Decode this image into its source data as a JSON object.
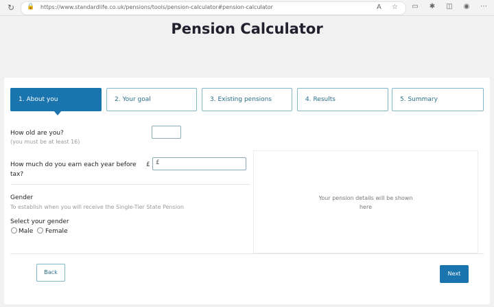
{
  "browser": {
    "url": "https://www.standardlife.co.uk/pensions/tools/pension-calculator#pension-calculator",
    "icons": [
      "reload-icon",
      "lock-icon",
      "read-aloud-icon",
      "favorite-icon",
      "tab-icon",
      "extensions-icon",
      "collections-icon",
      "profile-icon",
      "more-icon"
    ]
  },
  "page": {
    "title": "Pension Calculator"
  },
  "steps": [
    {
      "label": "1. About you",
      "active": true
    },
    {
      "label": "2. Your goal",
      "active": false
    },
    {
      "label": "3. Existing pensions",
      "active": false
    },
    {
      "label": "4. Results",
      "active": false
    },
    {
      "label": "5. Summary",
      "active": false
    }
  ],
  "form": {
    "age": {
      "label": "How old are you?",
      "hint": "(you must be at least 16)",
      "value": ""
    },
    "earnings": {
      "label_line1": "How much do you earn each year before",
      "label_line2": "tax?",
      "currency": "£",
      "value": "£"
    },
    "gender": {
      "title": "Gender",
      "hint": "To establish when you will receive the Single-Tier State Pension",
      "select_label": "Select your gender",
      "options": [
        "Male",
        "Female"
      ]
    }
  },
  "panel": {
    "line1": "Your pension details will be shown",
    "line2": "here"
  },
  "buttons": {
    "back": "Back",
    "next": "Next"
  },
  "colors": {
    "primary": "#1a74ae",
    "border": "#7fb6c8"
  }
}
